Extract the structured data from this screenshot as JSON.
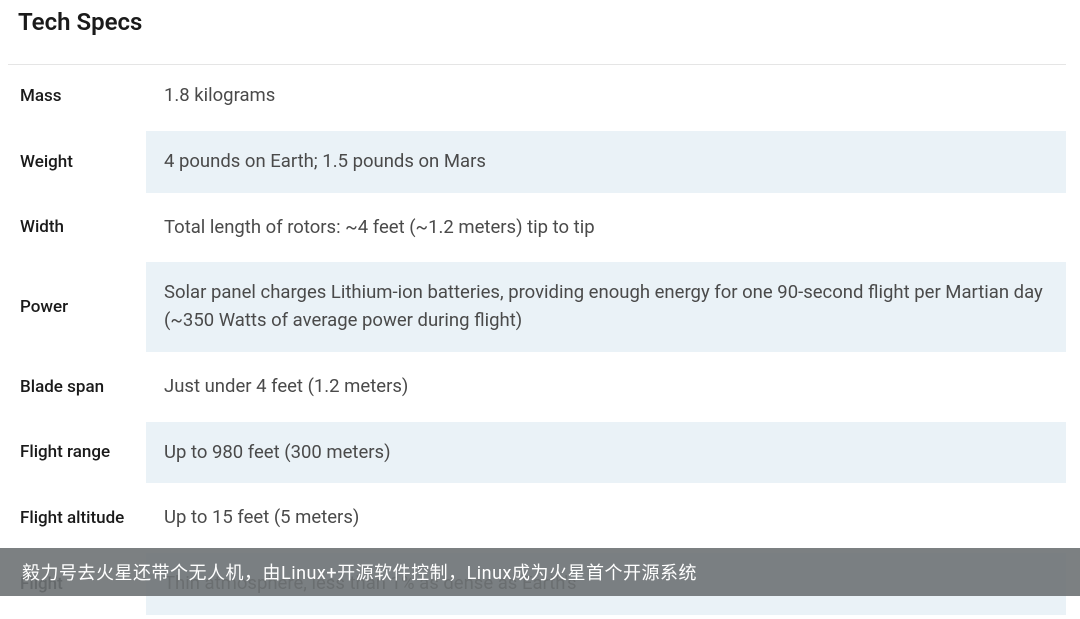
{
  "title": "Tech Specs",
  "rows": [
    {
      "label": "Mass",
      "value": "1.8 kilograms"
    },
    {
      "label": "Weight",
      "value": "4 pounds on Earth; 1.5 pounds on Mars"
    },
    {
      "label": "Width",
      "value": "Total length of rotors: ~4 feet (~1.2 meters) tip to tip"
    },
    {
      "label": "Power",
      "value": "Solar panel charges Lithium-ion batteries, providing enough energy for one 90-second flight per Martian day (~350 Watts of average power during flight)"
    },
    {
      "label": "Blade span",
      "value": "Just under 4 feet (1.2 meters)"
    },
    {
      "label": "Flight range",
      "value": "Up to 980 feet (300 meters)"
    },
    {
      "label": "Flight altitude",
      "value": "Up to 15 feet (5 meters)"
    },
    {
      "label": "Flight",
      "value": "Thin atmosphere, less than 1% as dense as Earth's"
    }
  ],
  "caption": "毅力号去火星还带个无人机，由Linux+开源软件控制，Linux成为火星首个开源系统"
}
